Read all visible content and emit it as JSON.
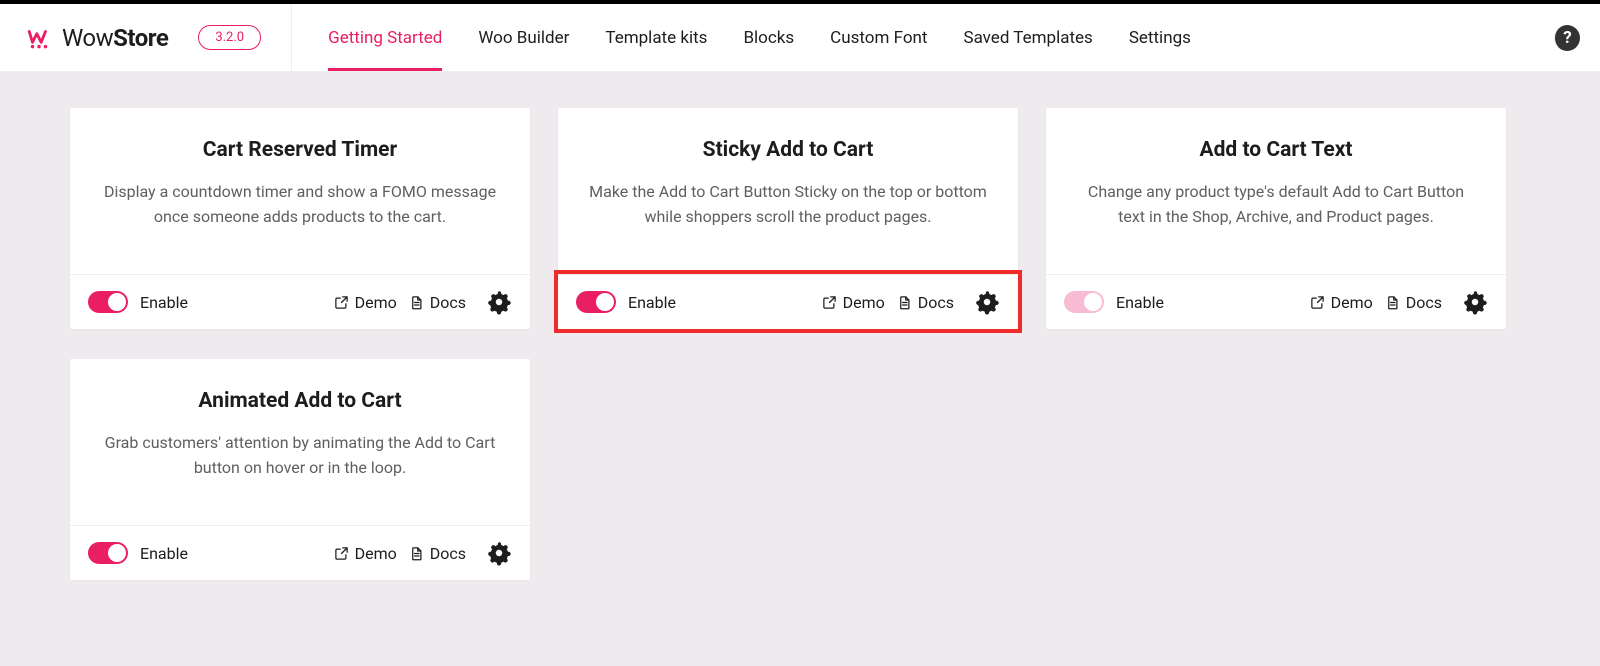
{
  "brand": {
    "name_light": "Wow",
    "name_bold": "Store",
    "version": "3.2.0"
  },
  "nav": [
    {
      "label": "Getting Started",
      "active": true
    },
    {
      "label": "Woo Builder",
      "active": false
    },
    {
      "label": "Template kits",
      "active": false
    },
    {
      "label": "Blocks",
      "active": false
    },
    {
      "label": "Custom Font",
      "active": false
    },
    {
      "label": "Saved Templates",
      "active": false
    },
    {
      "label": "Settings",
      "active": false
    }
  ],
  "footer_labels": {
    "enable": "Enable",
    "demo": "Demo",
    "docs": "Docs"
  },
  "cards": [
    {
      "id": "cart-reserved-timer",
      "title": "Cart Reserved Timer",
      "desc": "Display a countdown timer and show a FOMO message once someone adds products to the cart.",
      "enabled": true,
      "toggle_light": false,
      "highlight_footer": false
    },
    {
      "id": "sticky-add-to-cart",
      "title": "Sticky Add to Cart",
      "desc": "Make the Add to Cart Button Sticky on the top or bottom while shoppers scroll the product pages.",
      "enabled": true,
      "toggle_light": false,
      "highlight_footer": true
    },
    {
      "id": "add-to-cart-text",
      "title": "Add to Cart Text",
      "desc": "Change any product type's default Add to Cart Button text in the Shop, Archive, and Product pages.",
      "enabled": true,
      "toggle_light": true,
      "highlight_footer": false
    },
    {
      "id": "animated-add-to-cart",
      "title": "Animated Add to Cart",
      "desc": "Grab customers' attention by animating the Add to Cart button on hover or in the loop.",
      "enabled": true,
      "toggle_light": false,
      "highlight_footer": false
    }
  ]
}
